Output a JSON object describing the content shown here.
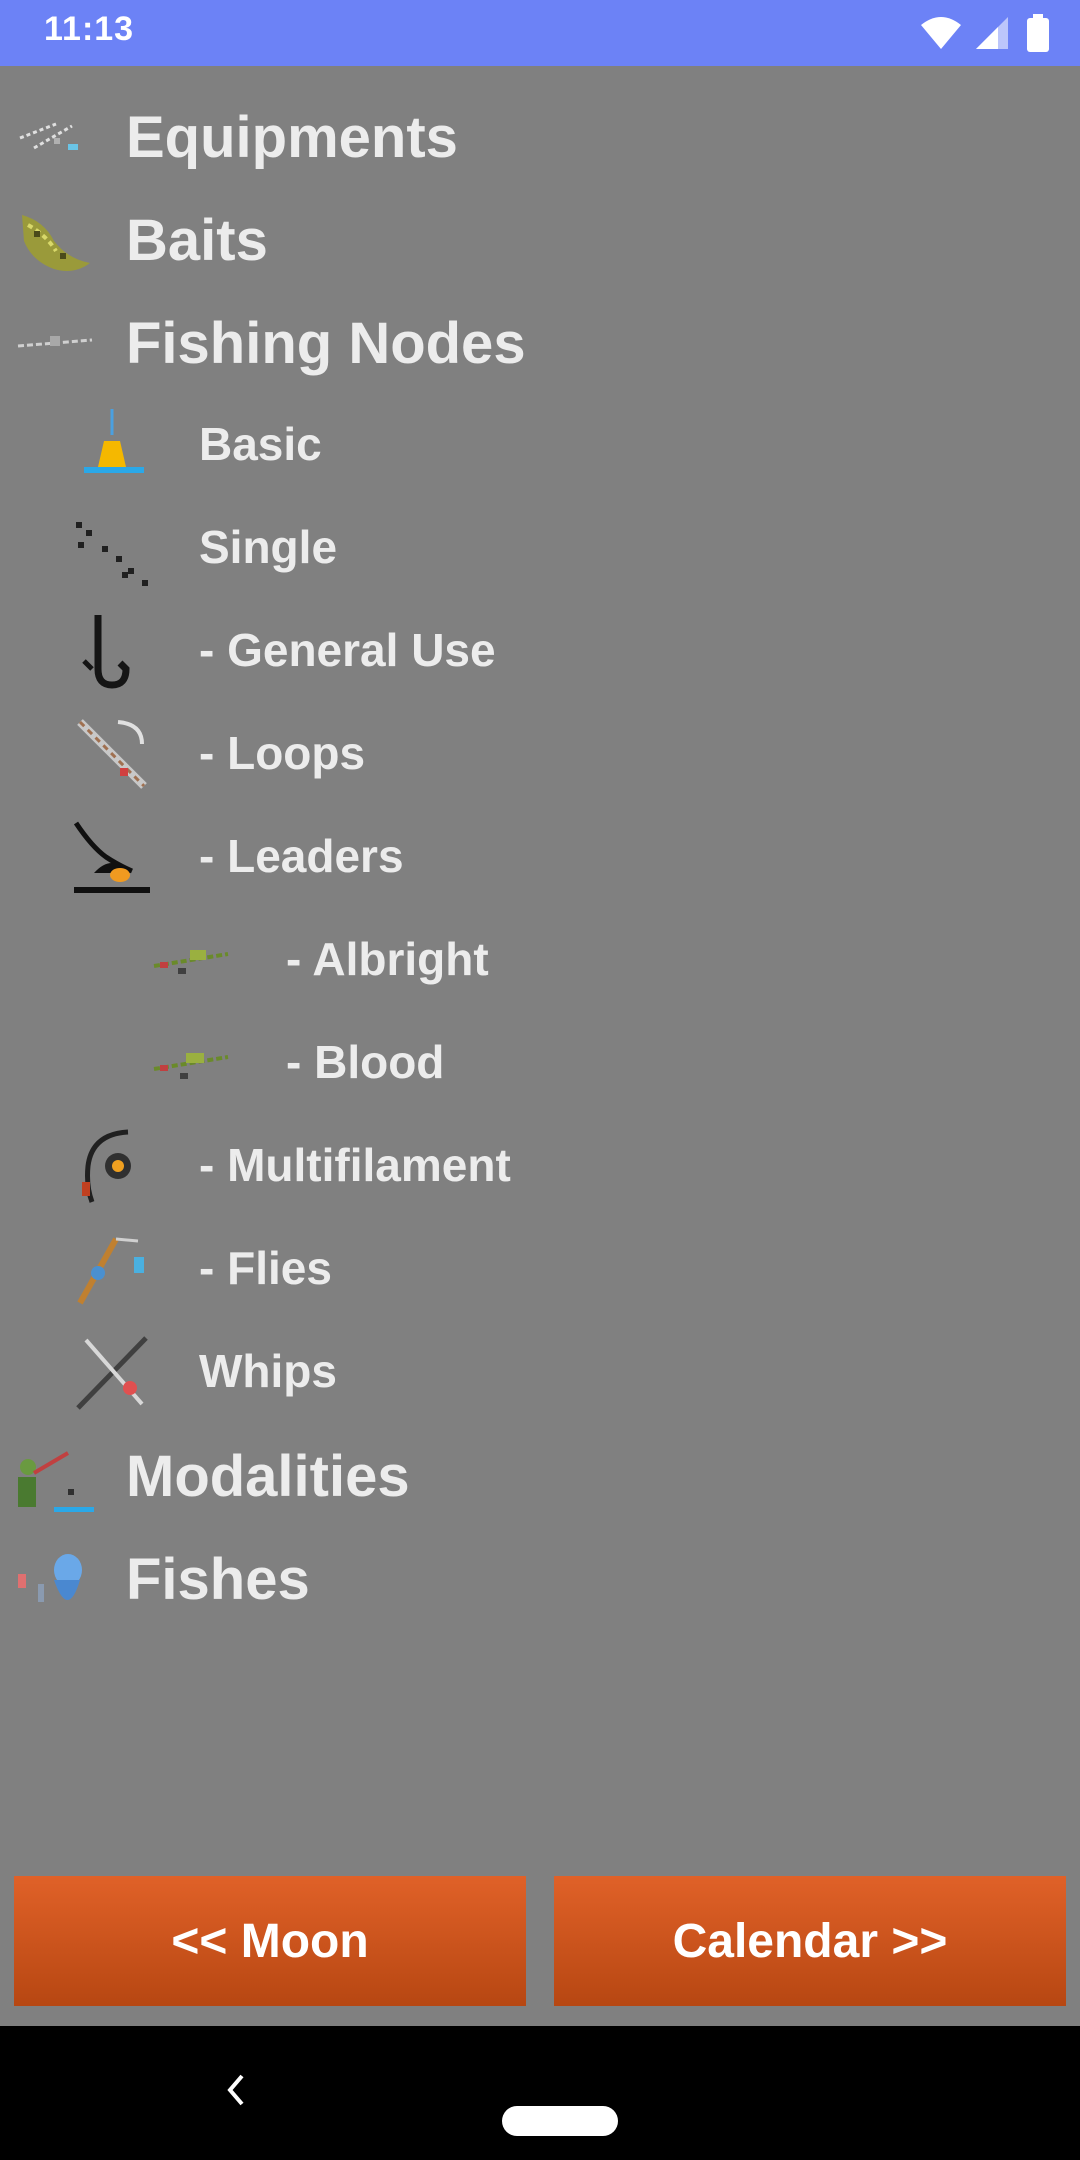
{
  "status_bar": {
    "time": "11:13"
  },
  "menu": {
    "items": [
      {
        "label": "Equipments",
        "icon": "equipment-icon"
      },
      {
        "label": "Baits",
        "icon": "bait-icon"
      },
      {
        "label": "Fishing Nodes",
        "icon": "line-knot-icon"
      },
      {
        "label": "Basic",
        "icon": "bobber-icon"
      },
      {
        "label": "Single",
        "icon": "dotted-line-icon"
      },
      {
        "label": "- General Use",
        "icon": "hook-icon"
      },
      {
        "label": "- Loops",
        "icon": "loop-knot-icon"
      },
      {
        "label": "- Leaders",
        "icon": "leader-line-icon"
      },
      {
        "label": "- Albright",
        "icon": "albright-knot-icon"
      },
      {
        "label": "- Blood",
        "icon": "blood-knot-icon"
      },
      {
        "label": "- Multifilament",
        "icon": "reel-icon"
      },
      {
        "label": "- Flies",
        "icon": "fly-rod-icon"
      },
      {
        "label": "Whips",
        "icon": "whip-icon"
      },
      {
        "label": "Modalities",
        "icon": "angler-icon"
      },
      {
        "label": "Fishes",
        "icon": "fish-icon"
      }
    ]
  },
  "nav": {
    "prev_label": "<< Moon",
    "next_label": "Calendar >>"
  },
  "colors": {
    "status_bar": "#6c82f6",
    "background": "#808080",
    "button": "#d45a20",
    "text": "#ececec"
  }
}
